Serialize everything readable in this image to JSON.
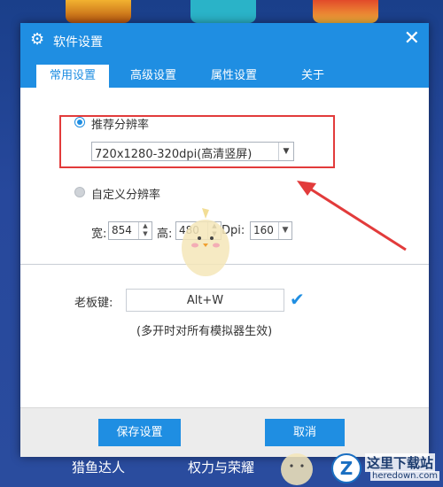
{
  "dialog": {
    "title": "软件设置",
    "close": "✕",
    "settings_icon": "gear-icon",
    "tabs": [
      {
        "label": "常用设置",
        "active": true
      },
      {
        "label": "高级设置",
        "active": false
      },
      {
        "label": "属性设置",
        "active": false
      },
      {
        "label": "关于",
        "active": false
      }
    ],
    "recommended": {
      "label": "推荐分辨率",
      "selected": true,
      "value": "720x1280-320dpi(高清竖屏)"
    },
    "custom": {
      "label": "自定义分辨率",
      "selected": false,
      "width_label": "宽:",
      "width_value": "854",
      "height_label": "高:",
      "height_value": "480",
      "dpi_label": "Dpi:",
      "dpi_value": "160"
    },
    "boss_key": {
      "label": "老板键:",
      "value": "Alt+W",
      "note": "(多开时对所有模拟器生效)"
    },
    "buttons": {
      "save": "保存设置",
      "cancel": "取消"
    }
  },
  "background": {
    "game_labels": [
      "猎鱼达人",
      "权力与荣耀"
    ]
  },
  "watermark": {
    "logo_letter": "Z",
    "text_cn": "这里下载站",
    "text_en": "heredown.com"
  },
  "colors": {
    "accent": "#1f8ee2",
    "highlight": "#e23b3b",
    "background": "#27489c"
  }
}
